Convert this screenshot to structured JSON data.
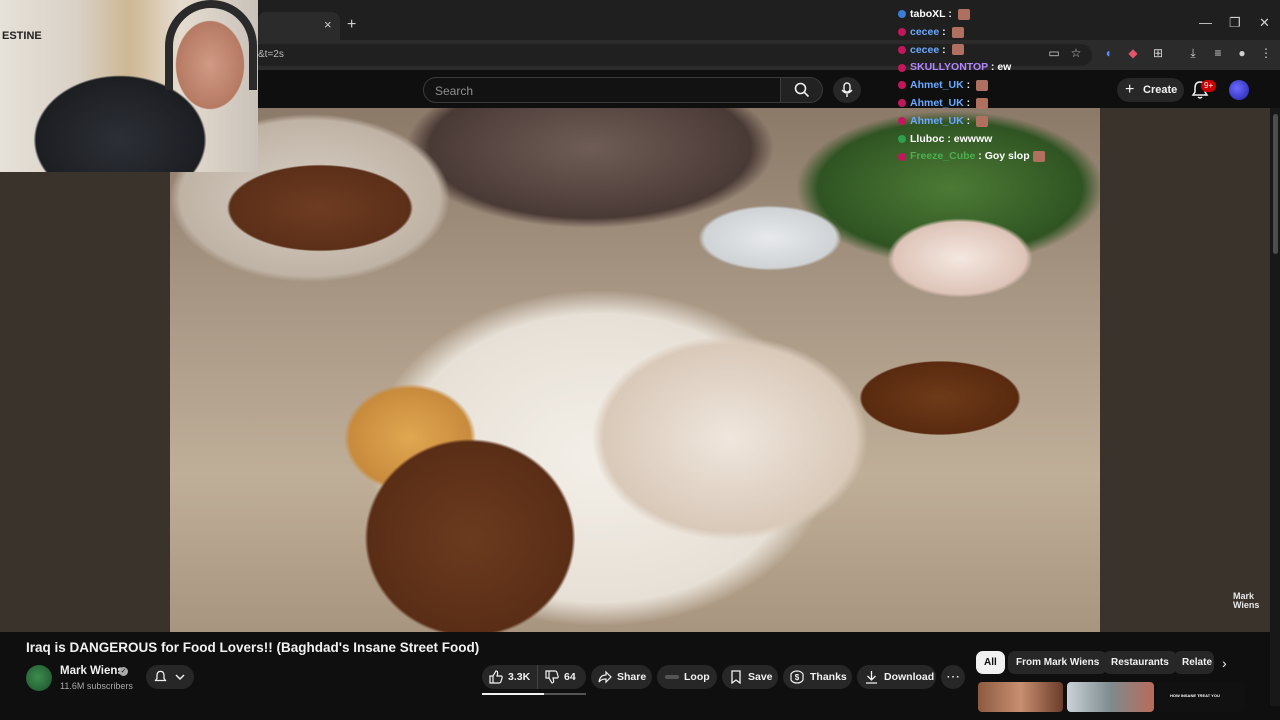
{
  "browser": {
    "url": "&t=2s",
    "new_tab": "+",
    "tab_close": "×",
    "window_controls": [
      "—",
      "❐",
      "✕"
    ]
  },
  "header": {
    "search_placeholder": "Search",
    "create_label": "Create",
    "notification_count": "9+"
  },
  "webcam": {
    "wall_text": "ESTINE"
  },
  "chat": [
    {
      "user": "taboXL",
      "color": "#ffffff",
      "badge_color": "#3b7dd8",
      "message": "",
      "emote": true
    },
    {
      "user": "cecee",
      "color": "#6aa9ff",
      "badge_color": "#c2185b",
      "message": "",
      "emote": true
    },
    {
      "user": "cecee",
      "color": "#6aa9ff",
      "badge_color": "#c2185b",
      "message": "",
      "emote": true
    },
    {
      "user": "SKULLYONTOP",
      "color": "#b388ff",
      "badge_color": "#c2185b",
      "message": "ew",
      "emote": false
    },
    {
      "user": "Ahmet_UK",
      "color": "#6aa9ff",
      "badge_color": "#c2185b",
      "message": "",
      "emote": true
    },
    {
      "user": "Ahmet_UK",
      "color": "#6aa9ff",
      "badge_color": "#c2185b",
      "message": "",
      "emote": true
    },
    {
      "user": "Ahmet_UK",
      "color": "#6aa9ff",
      "badge_color": "#c2185b",
      "message": "",
      "emote": true
    },
    {
      "user": "Lluboc",
      "color": "#ffffff",
      "badge_color": "#2e9e4f",
      "message": "ewwww",
      "emote": false
    },
    {
      "user": "Freeze_Cube",
      "color": "#4caf50",
      "badge_color": "#c2185b",
      "message": "Goy slop",
      "emote": true
    }
  ],
  "video": {
    "title": "Iraq is DANGEROUS for Food Lovers!! (Baghdad's Insane Street Food)",
    "watermark_line1": "Mark",
    "watermark_line2": "Wiens"
  },
  "channel": {
    "name": "Mark Wiens",
    "subscribers": "11.6M subscribers"
  },
  "actions": {
    "likes": "3.3K",
    "dislikes": "64",
    "share": "Share",
    "loop": "Loop",
    "save": "Save",
    "thanks": "Thanks",
    "download": "Download",
    "like_ratio": 0.6
  },
  "chips": [
    "All",
    "From Mark Wiens",
    "Restaurants",
    "Relate"
  ],
  "thumbnail_text": "HOW INSANE TREAT YOU"
}
